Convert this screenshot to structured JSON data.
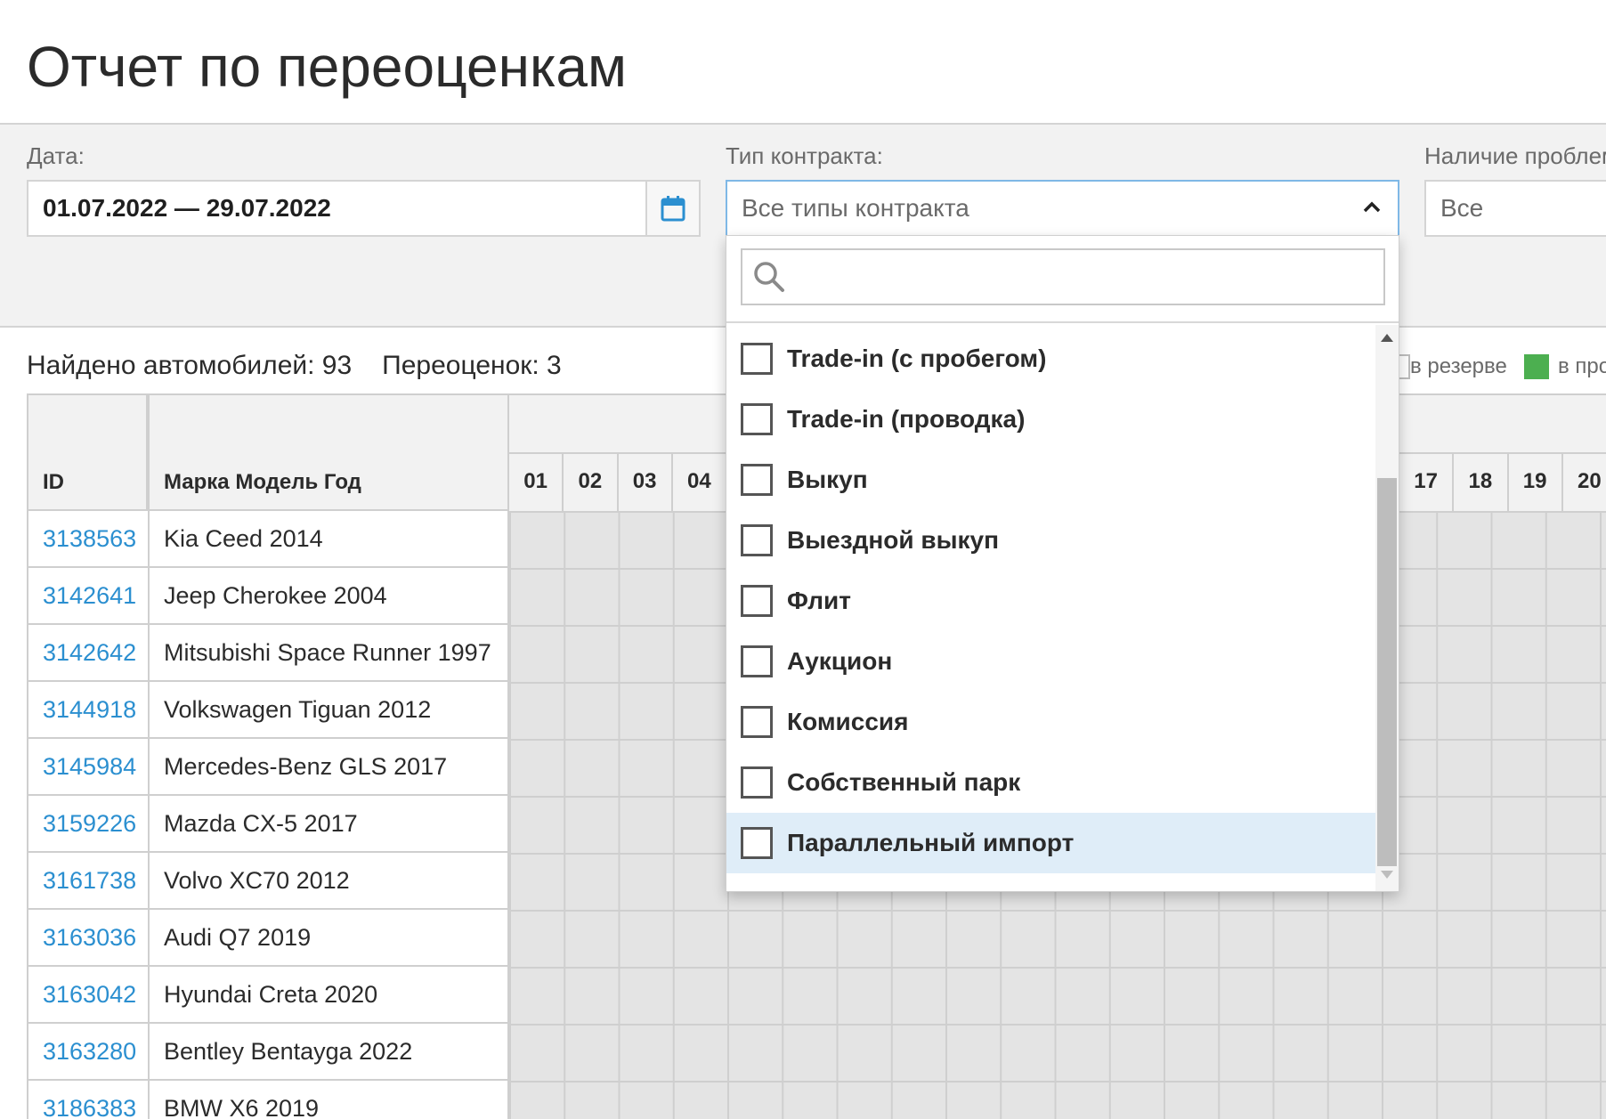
{
  "page": {
    "title": "Отчет по переоценкам"
  },
  "filters": {
    "date": {
      "label": "Дата:",
      "value": "01.07.2022 — 29.07.2022",
      "calendar_icon": "calendar-icon"
    },
    "contract_type": {
      "label": "Тип контракта:",
      "placeholder": "Все типы контракта",
      "state": "open"
    },
    "problems": {
      "label": "Наличие проблем",
      "value": "Все"
    }
  },
  "summary": {
    "found_text": "Найдено автомобилей: 93",
    "revaluations_text": "Переоценок: 3"
  },
  "legend": {
    "reserve_label": "в резерве",
    "sale_label": "в про",
    "sale_color": "#4caf50"
  },
  "table": {
    "headers": {
      "id": "ID",
      "model": "Марка Модель Год"
    },
    "days": [
      "01",
      "02",
      "03",
      "04",
      "17",
      "18",
      "19",
      "20"
    ],
    "rows": [
      {
        "id": "3138563",
        "model": "Kia Ceed 2014"
      },
      {
        "id": "3142641",
        "model": "Jeep Cherokee 2004"
      },
      {
        "id": "3142642",
        "model": "Mitsubishi Space Runner 1997"
      },
      {
        "id": "3144918",
        "model": "Volkswagen Tiguan 2012"
      },
      {
        "id": "3145984",
        "model": "Mercedes-Benz GLS 2017"
      },
      {
        "id": "3159226",
        "model": "Mazda CX-5 2017"
      },
      {
        "id": "3161738",
        "model": "Volvo XC70 2012"
      },
      {
        "id": "3163036",
        "model": "Audi Q7 2019"
      },
      {
        "id": "3163042",
        "model": "Hyundai Creta 2020"
      },
      {
        "id": "3163280",
        "model": "Bentley Bentayga 2022"
      },
      {
        "id": "3186383",
        "model": "BMW X6 2019"
      }
    ]
  },
  "dropdown": {
    "search_placeholder": "",
    "options": [
      {
        "label": "Trade-in (с пробегом)",
        "checked": false
      },
      {
        "label": "Trade-in (проводка)",
        "checked": false
      },
      {
        "label": "Выкуп",
        "checked": false
      },
      {
        "label": "Выездной выкуп",
        "checked": false
      },
      {
        "label": "Флит",
        "checked": false
      },
      {
        "label": "Аукцион",
        "checked": false
      },
      {
        "label": "Комиссия",
        "checked": false
      },
      {
        "label": "Собственный парк",
        "checked": false
      },
      {
        "label": "Параллельный импорт",
        "checked": false,
        "highlighted": true
      }
    ]
  },
  "colors": {
    "accent": "#2b8fd0",
    "highlight": "#dfedf8"
  }
}
